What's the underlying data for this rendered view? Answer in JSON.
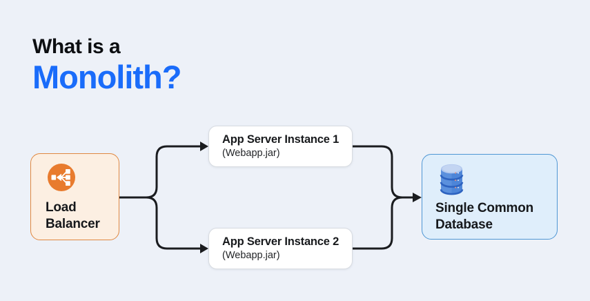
{
  "title": {
    "line1": "What is a",
    "line2": "Monolith?"
  },
  "nodes": {
    "load_balancer": {
      "label": "Load Balancer",
      "icon": "load-balancer-icon"
    },
    "app_server_1": {
      "title": "App Server Instance 1",
      "subtitle": "(Webapp.jar)"
    },
    "app_server_2": {
      "title": "App Server Instance 2",
      "subtitle": "(Webapp.jar)"
    },
    "database": {
      "label": "Single Common Database",
      "icon": "database-icon"
    }
  },
  "colors": {
    "background": "#edf1f8",
    "title_dark": "#0d0f12",
    "accent_blue": "#1a6cfa",
    "lb_fill": "#fcefe2",
    "lb_border": "#e0873f",
    "lb_icon_orange": "#e87b2e",
    "app_box_fill": "#ffffff",
    "app_box_border": "#d7dbe1",
    "db_fill": "#dfeefb",
    "db_border": "#4e96d4",
    "db_icon_blue": "#4d85d8",
    "connector": "#1a1c1f"
  }
}
